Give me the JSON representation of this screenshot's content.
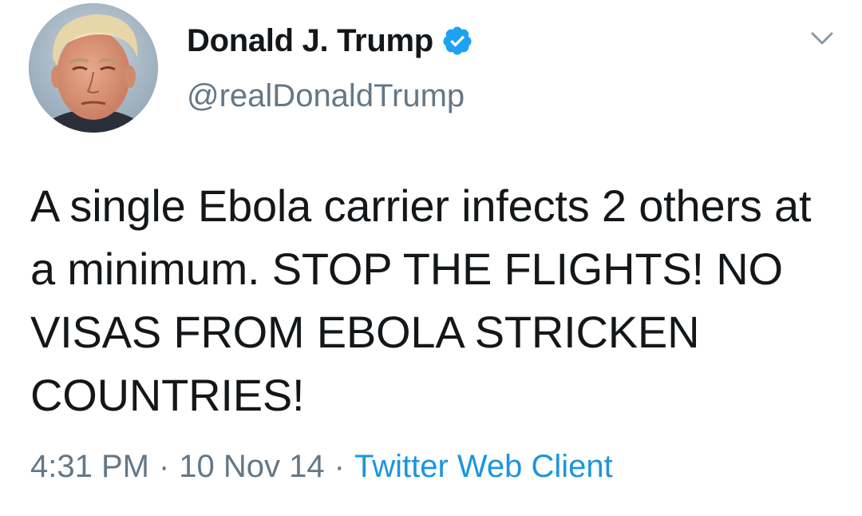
{
  "tweet": {
    "display_name": "Donald J. Trump",
    "handle": "@realDonaldTrump",
    "verified": true,
    "text": "A single Ebola carrier infects 2 others at a minimum. STOP THE FLIGHTS! NO VISAS FROM EBOLA STRICKEN COUNTRIES!",
    "time": "4:31 PM",
    "date": "10 Nov 14",
    "separator": "·",
    "source": "Twitter Web Client"
  },
  "icons": {
    "verified": "verified-badge-icon",
    "menu": "chevron-down-icon"
  },
  "colors": {
    "text": "#14171a",
    "secondary": "#657786",
    "link": "#1b95e0",
    "verified": "#1da1f2"
  }
}
